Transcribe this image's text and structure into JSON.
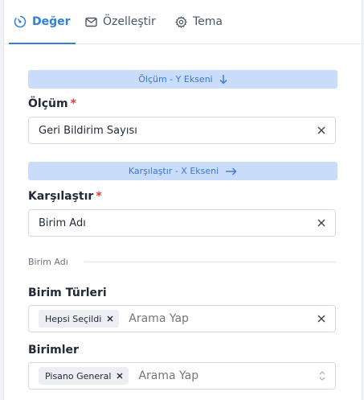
{
  "tabs": [
    {
      "label": "Değer",
      "icon": "value-icon",
      "active": true
    },
    {
      "label": "Özelleştir",
      "icon": "envelope-icon",
      "active": false
    },
    {
      "label": "Tema",
      "icon": "gear-icon",
      "active": false
    }
  ],
  "measure_section": {
    "title": "Ölçüm - Y Ekseni",
    "icon": "arrow-down-icon"
  },
  "measure_field": {
    "label": "Ölçüm",
    "required_mark": "*",
    "value": "Geri Bildirim Sayısı"
  },
  "compare_section": {
    "title": "Karşılaştır - X Ekseni",
    "icon": "arrow-right-icon"
  },
  "compare_field": {
    "label": "Karşılaştır",
    "required_mark": "*",
    "value": "Birim Adı"
  },
  "divider": {
    "label": "Birim Adı"
  },
  "unit_types": {
    "label": "Birim Türleri",
    "chip": "Hepsi Seçildi",
    "placeholder": "Arama Yap"
  },
  "units": {
    "label": "Birimler",
    "chip": "Pisano General",
    "placeholder": "Arama Yap"
  },
  "colors": {
    "accent": "#2f80d9",
    "section_bg": "#c9dcf9",
    "required": "#e53935"
  }
}
